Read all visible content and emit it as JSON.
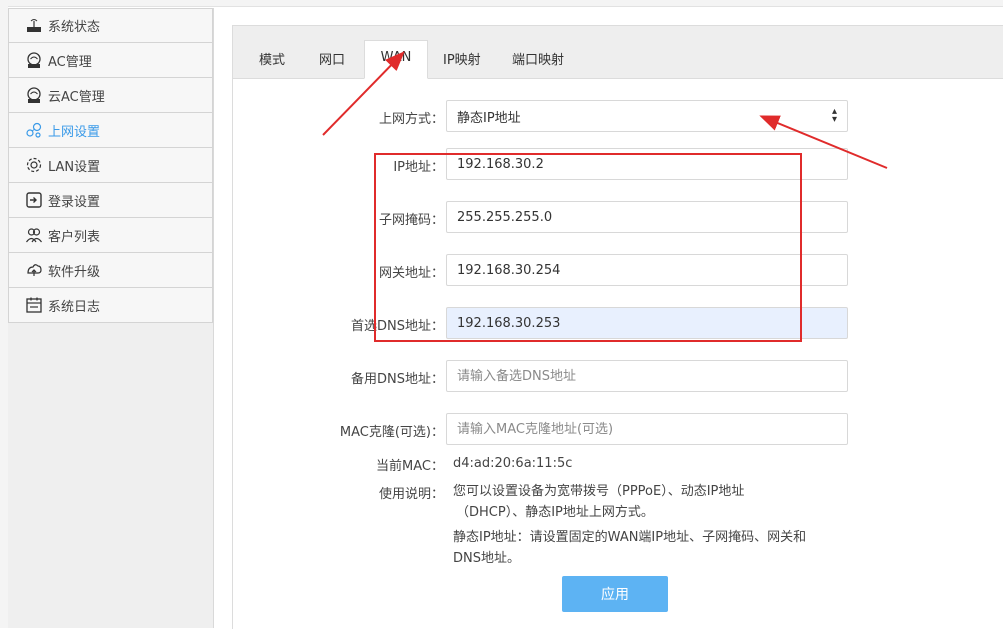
{
  "sidebar": {
    "items": [
      {
        "label": "系统状态",
        "icon": "router-icon"
      },
      {
        "label": "AC管理",
        "icon": "ac-icon"
      },
      {
        "label": "云AC管理",
        "icon": "cloud-ac-icon"
      },
      {
        "label": "上网设置",
        "icon": "network-icon",
        "active": true
      },
      {
        "label": "LAN设置",
        "icon": "gear-icon"
      },
      {
        "label": "登录设置",
        "icon": "login-icon"
      },
      {
        "label": "客户列表",
        "icon": "users-icon"
      },
      {
        "label": "软件升级",
        "icon": "upgrade-icon"
      },
      {
        "label": "系统日志",
        "icon": "calendar-icon"
      }
    ]
  },
  "tabs": [
    {
      "label": "模式"
    },
    {
      "label": "网口"
    },
    {
      "label": "WAN",
      "active": true
    },
    {
      "label": "IP映射"
    },
    {
      "label": "端口映射"
    }
  ],
  "form": {
    "mode_label": "上网方式：",
    "mode_value": "静态IP地址",
    "ip_label": "IP地址：",
    "ip_value": "192.168.30.2",
    "mask_label": "子网掩码：",
    "mask_value": "255.255.255.0",
    "gateway_label": "网关地址：",
    "gateway_value": "192.168.30.254",
    "dns1_label": "首选DNS地址：",
    "dns1_value": "192.168.30.253",
    "dns2_label": "备用DNS地址：",
    "dns2_placeholder": "请输入备选DNS地址",
    "mac_clone_label": "MAC克隆(可选)：",
    "mac_clone_placeholder": "请输入MAC克隆地址(可选)",
    "current_mac_label": "当前MAC：",
    "current_mac_value": "d4:ad:20:6a:11:5c",
    "usage_label": "使用说明：",
    "usage_line1": "您可以设置设备为宽带拨号（PPPoE）、动态IP地址",
    "usage_line2": "（DHCP）、静态IP地址上网方式。",
    "static_note_line1": "静态IP地址：请设置固定的WAN端IP地址、子网掩码、网关和",
    "static_note_line2": "DNS地址。",
    "apply_label": "应用"
  },
  "colors": {
    "accent": "#3a9ae8",
    "apply_button": "#5db3f3",
    "annotation_red": "#e02b2b",
    "highlight_field": "#e8f0fe"
  }
}
